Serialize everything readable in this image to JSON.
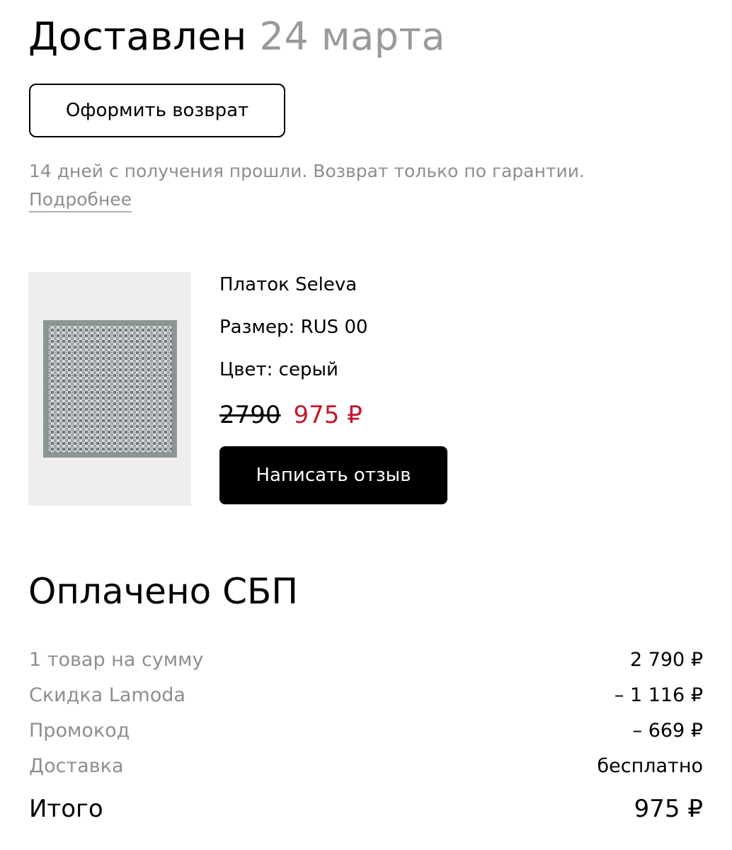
{
  "status": {
    "title": "Доставлен",
    "date": "24 марта"
  },
  "return_button_label": "Оформить возврат",
  "return_notice": {
    "text": "14 дней с получения прошли. Возврат только по гарантии.",
    "link": "Подробнее"
  },
  "product": {
    "name": "Платок Seleva",
    "size": "Размер: RUS 00",
    "color": "Цвет: серый",
    "old_price": "2790",
    "new_price": "975 ₽",
    "image_icon": "scarf-image"
  },
  "review_button_label": "Написать отзыв",
  "payment": {
    "title": "Оплачено СБП",
    "rows": [
      {
        "label": "1 товар на сумму",
        "value": "2 790 ₽"
      },
      {
        "label": "Скидка Lamoda",
        "value": "– 1 116 ₽"
      },
      {
        "label": "Промокод",
        "value": "– 669 ₽"
      },
      {
        "label": "Доставка",
        "value": "бесплатно"
      }
    ],
    "total": {
      "label": "Итого",
      "value": "975 ₽"
    }
  },
  "colors": {
    "accent_price": "#c3182b",
    "muted_text": "#8e8e8e",
    "primary_button": "#000000"
  }
}
